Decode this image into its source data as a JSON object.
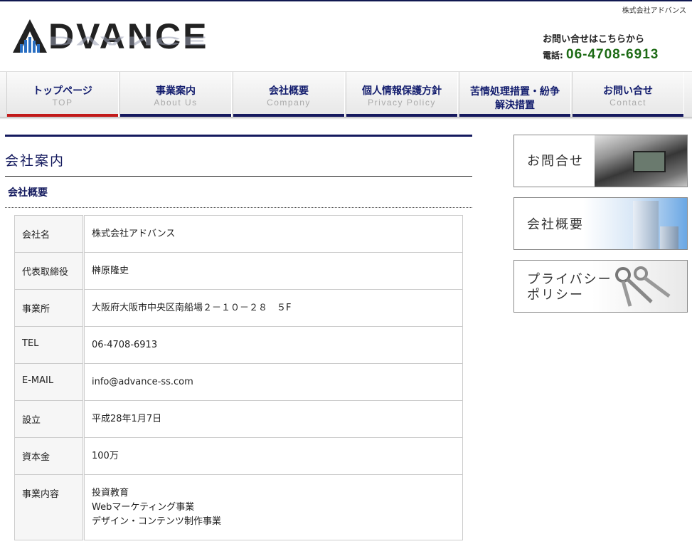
{
  "header": {
    "company_name": "株式会社アドバンス",
    "logo_text": "DVANCE",
    "contact_lead": "お問い合せはこちらから",
    "tel_label": "電話:",
    "tel_number": "06-4708-6913"
  },
  "nav": [
    {
      "jp": "トップページ",
      "en": "TOP"
    },
    {
      "jp": "事業案内",
      "en": "About Us"
    },
    {
      "jp": "会社概要",
      "en": "Company"
    },
    {
      "jp": "個人情報保護方針",
      "en": "Privacy Policy"
    },
    {
      "jp": "苦情処理措置・紛争",
      "jp2": "解決措置"
    },
    {
      "jp": "お問い合せ",
      "en": "Contact"
    }
  ],
  "main": {
    "title": "会社案内",
    "subtitle": "会社概要",
    "rows": [
      {
        "label": "会社名",
        "value": "株式会社アドバンス"
      },
      {
        "label": "代表取締役",
        "value": "榊原隆史"
      },
      {
        "label": "事業所",
        "value": "大阪府大阪市中央区南船場２－１０－２８　５F"
      },
      {
        "label": "TEL",
        "value": "06-4708-6913"
      },
      {
        "label": "E-MAIL",
        "value": "info@advance-ss.com"
      },
      {
        "label": "設立",
        "value": "平成28年1月7日"
      },
      {
        "label": "資本金",
        "value": "100万"
      },
      {
        "label": "事業内容",
        "values": [
          "投資教育",
          "Webマーケティング事業",
          "デザイン・コンテンツ制作事業"
        ]
      }
    ]
  },
  "sidebar": {
    "contact": "お問合せ",
    "company": "会社概要",
    "privacy_line1": "プライバシー",
    "privacy_line2": "ポリシー"
  }
}
